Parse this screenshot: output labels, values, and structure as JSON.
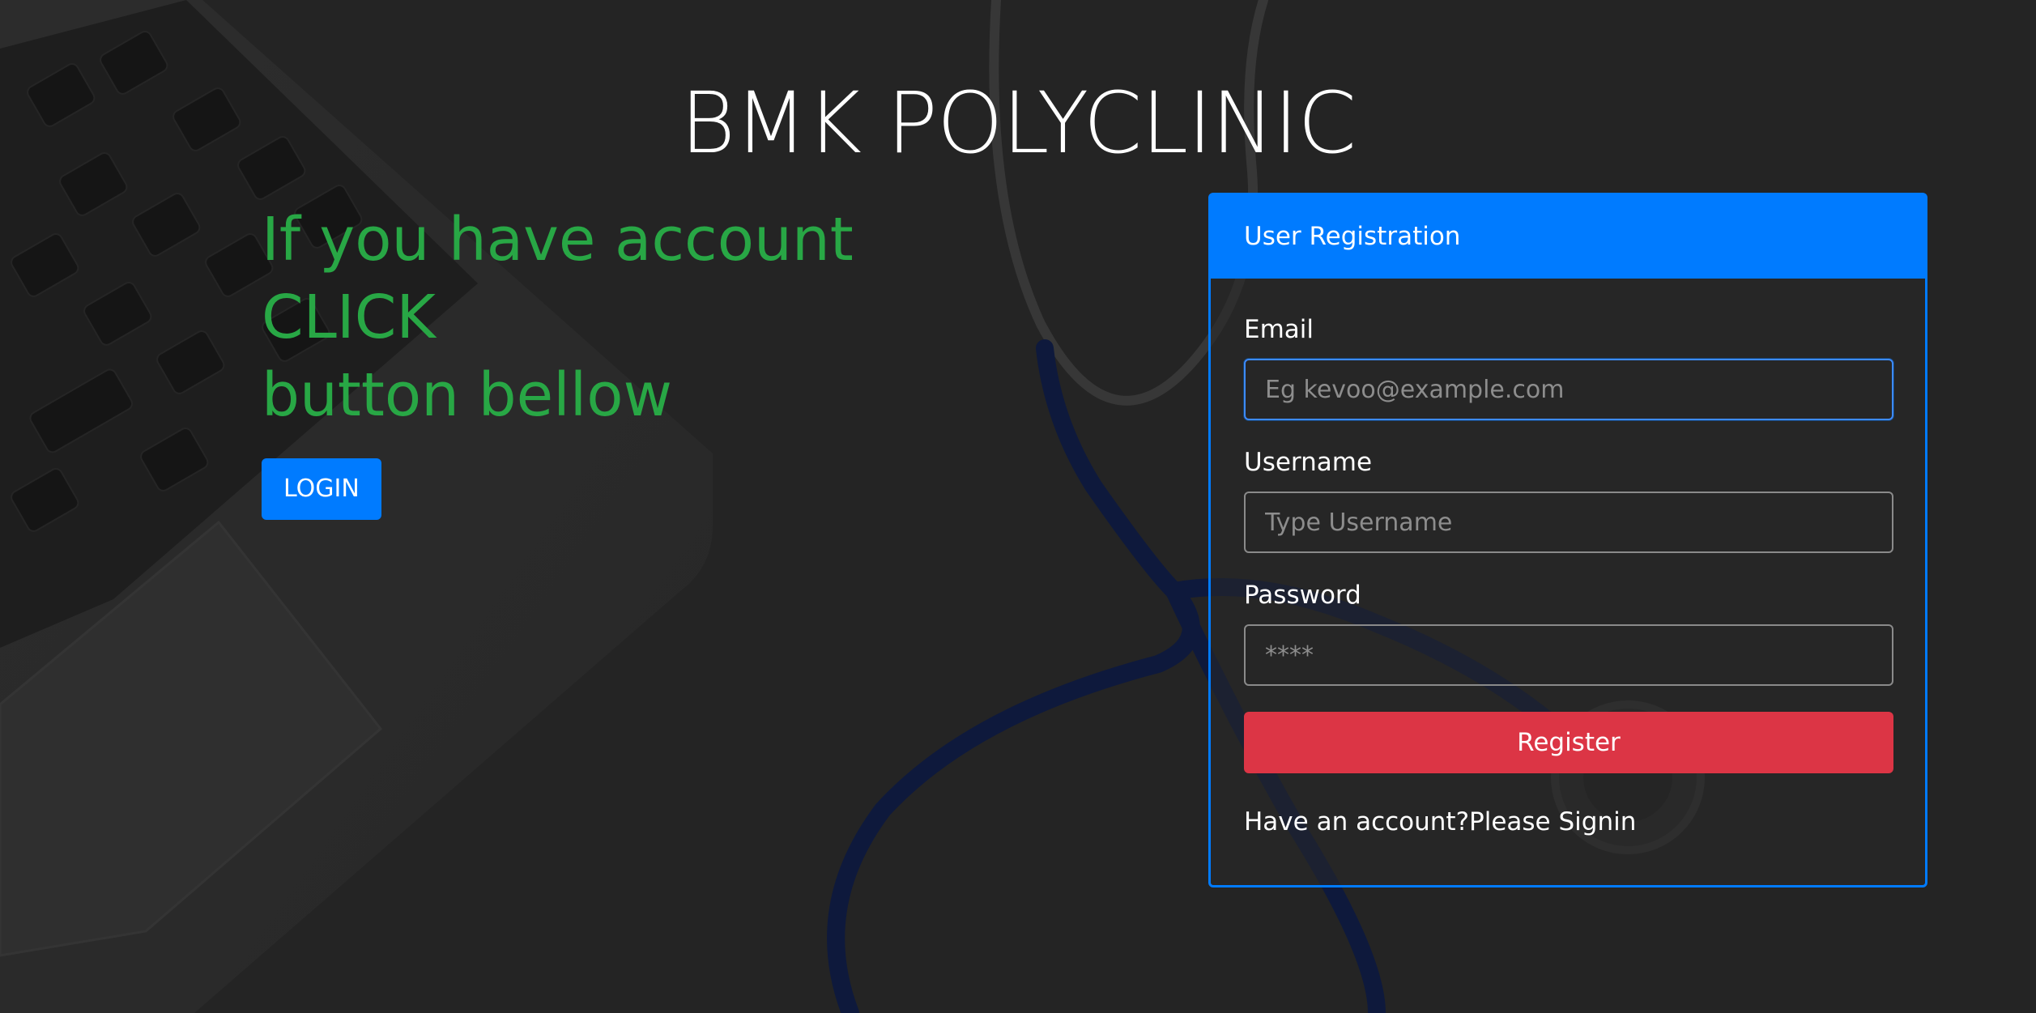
{
  "page": {
    "title": "BMK POLYCLINIC",
    "background": "dark desk photo with laptop keyboard and blue stethoscope"
  },
  "left": {
    "heading_line1": "If you have account CLICK",
    "heading_line2": "button bellow",
    "login_label": "LOGIN"
  },
  "registration": {
    "header": "User Registration",
    "email": {
      "label": "Email",
      "placeholder": "Eg kevoo@example.com"
    },
    "username": {
      "label": "Username",
      "placeholder": "Type Username"
    },
    "password": {
      "label": "Password",
      "placeholder": "****"
    },
    "register_label": "Register",
    "have_account_text": "Have an account?",
    "signin_label": "Please Signin"
  },
  "colors": {
    "primary": "#007bff",
    "success": "#28a745",
    "danger": "#dc3545",
    "background": "#2d2d2d"
  }
}
